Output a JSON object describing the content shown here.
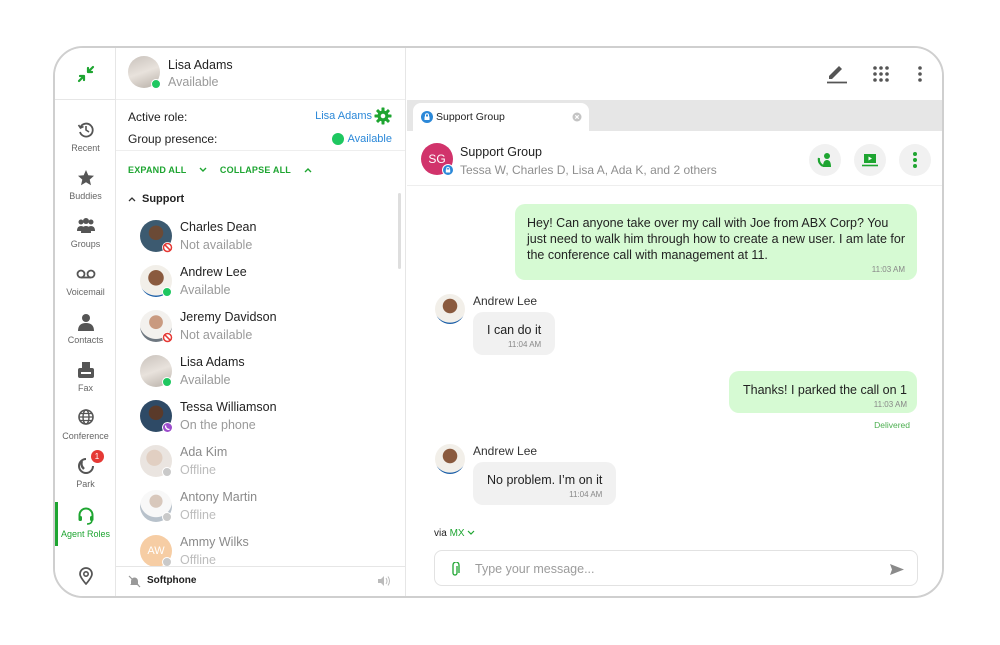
{
  "nav": {
    "items": [
      {
        "label": "Recent",
        "icon": "history-icon"
      },
      {
        "label": "Buddies",
        "icon": "star-icon"
      },
      {
        "label": "Groups",
        "icon": "groups-icon"
      },
      {
        "label": "Voicemail",
        "icon": "voicemail-icon"
      },
      {
        "label": "Contacts",
        "icon": "person-icon"
      },
      {
        "label": "Fax",
        "icon": "fax-icon"
      },
      {
        "label": "Conference",
        "icon": "globe-icon"
      },
      {
        "label": "Park",
        "icon": "park-icon",
        "badge": "1"
      },
      {
        "label": "Agent Roles",
        "icon": "headset-icon",
        "active": true
      }
    ]
  },
  "me": {
    "name": "Lisa Adams",
    "status": "Available"
  },
  "roles": {
    "active_role_label": "Active role:",
    "active_role_value": "Lisa Adams",
    "group_presence_label": "Group presence:",
    "group_presence_value": "Available"
  },
  "controls": {
    "expand_all": "EXPAND ALL",
    "collapse_all": "COLLAPSE ALL"
  },
  "group": {
    "name": "Support",
    "contacts": [
      {
        "name": "Charles Dean",
        "status": "Not available",
        "presence": "dnd"
      },
      {
        "name": "Andrew Lee",
        "status": "Available",
        "presence": "available"
      },
      {
        "name": "Jeremy Davidson",
        "status": "Not available",
        "presence": "dnd"
      },
      {
        "name": "Lisa Adams",
        "status": "Available",
        "presence": "available"
      },
      {
        "name": "Tessa Williamson",
        "status": "On the phone",
        "presence": "phone"
      },
      {
        "name": "Ada Kim",
        "status": "Offline",
        "presence": "offline"
      },
      {
        "name": "Antony Martin",
        "status": "Offline",
        "presence": "offline"
      },
      {
        "name": "Ammy Wilks",
        "status": "Offline",
        "presence": "offline",
        "initials": "AW"
      }
    ]
  },
  "softphone": {
    "label": "Softphone"
  },
  "tab": {
    "label": "Support Group"
  },
  "conversation": {
    "initials": "SG",
    "name": "Support Group",
    "members": "Tessa W, Charles D, Lisa A, Ada K, and 2 others"
  },
  "messages": [
    {
      "direction": "out",
      "text": "Hey! Can anyone take over my call with Joe from ABX Corp? You just need to walk him through how to create a new user. I am late for the conference call with management at 11.",
      "time": "11:03 AM"
    },
    {
      "direction": "in",
      "sender": "Andrew Lee",
      "text": "I can do it",
      "time": "11:04 AM"
    },
    {
      "direction": "out",
      "text": "Thanks! I parked the call on 1",
      "time": "11:03 AM",
      "status": "Delivered"
    },
    {
      "direction": "in",
      "sender": "Andrew Lee",
      "text": "No problem. I’m on it",
      "time": "11:04 AM"
    }
  ],
  "composer": {
    "via_label": "via",
    "via_value": "MX",
    "placeholder": "Type your message..."
  },
  "colors": {
    "accent": "#1ea531",
    "link": "#2b88d8",
    "bubble_out": "#d6fad3",
    "bubble_in": "#f1f1f1",
    "group_avatar": "#d1336b",
    "badge": "#e53935"
  }
}
